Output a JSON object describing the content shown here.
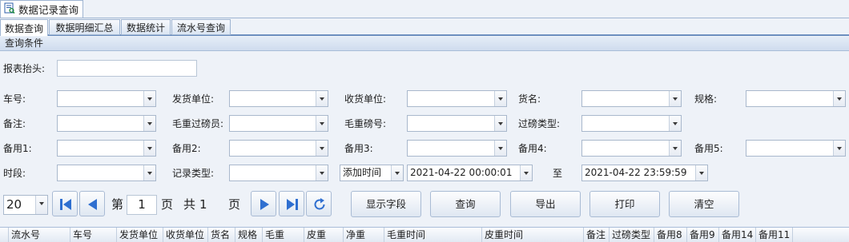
{
  "window": {
    "title": "数据记录查询"
  },
  "tabs": [
    {
      "label": "数据查询"
    },
    {
      "label": "数据明细汇总"
    },
    {
      "label": "数据统计"
    },
    {
      "label": "流水号查询"
    }
  ],
  "panel": {
    "header": "查询条件"
  },
  "form": {
    "report_header_label": "报表抬头:",
    "labels": {
      "vehicle": "车号:",
      "shipper": "发货单位:",
      "receiver": "收货单位:",
      "goods": "货名:",
      "spec": "规格:",
      "remark": "备注:",
      "gross_weigher": "毛重过磅员:",
      "gross_scale": "毛重磅号:",
      "weigh_type": "过磅类型:",
      "spare1": "备用1:",
      "spare2": "备用2:",
      "spare3": "备用3:",
      "spare4": "备用4:",
      "spare5": "备用5:",
      "period": "时段:",
      "record_type": "记录类型:",
      "to": "至"
    },
    "time_field": "添加时间",
    "start_datetime": "2021-04-22 00:00:01",
    "end_datetime": "2021-04-22 23:59:59"
  },
  "pager": {
    "page_size": "20",
    "prefix": "第",
    "current_page": "1",
    "page_suffix": "页",
    "total_prefix": "共",
    "total_pages": "1",
    "total_suffix": "页"
  },
  "actions": {
    "show_fields": "显示字段",
    "query": "查询",
    "export": "导出",
    "print": "打印",
    "clear": "清空"
  },
  "grid": {
    "columns": [
      "流水号",
      "车号",
      "发货单位",
      "收货单位",
      "货名",
      "规格",
      "毛重",
      "皮重",
      "净重",
      "毛重时间",
      "皮重时间",
      "备注",
      "过磅类型",
      "备用8",
      "备用9",
      "备用14",
      "备用11"
    ]
  },
  "colors": {
    "accent": "#2f6fd0",
    "border": "#a9bbd4"
  }
}
